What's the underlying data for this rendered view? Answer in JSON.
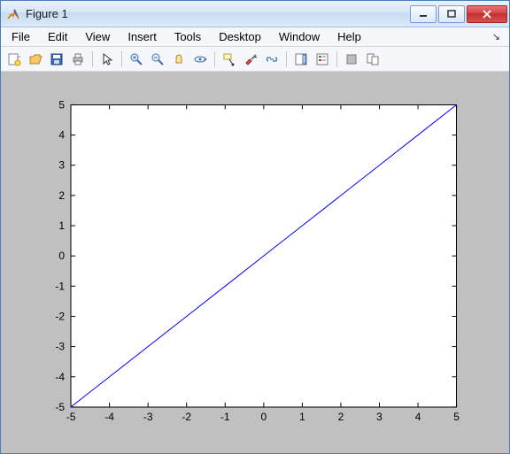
{
  "window": {
    "title": "Figure 1"
  },
  "menu": {
    "items": [
      "File",
      "Edit",
      "View",
      "Insert",
      "Tools",
      "Desktop",
      "Window",
      "Help"
    ]
  },
  "toolbar": {
    "groups": [
      [
        "new-figure-icon",
        "open-icon",
        "save-icon",
        "print-icon"
      ],
      [
        "pointer-icon"
      ],
      [
        "zoom-in-icon",
        "zoom-out-icon",
        "pan-icon",
        "rotate3d-icon"
      ],
      [
        "datacursor-icon",
        "brush-icon",
        "link-icon"
      ],
      [
        "colorbar-icon",
        "legend-icon"
      ],
      [
        "hide-plot-tools-icon",
        "show-plot-tools-icon"
      ]
    ]
  },
  "colors": {
    "line": "#0000ff",
    "axes_bg": "#ffffff",
    "figure_bg": "#c0c0c0"
  },
  "chart_data": {
    "type": "line",
    "x": [
      -5,
      -4,
      -3,
      -2,
      -1,
      0,
      1,
      2,
      3,
      4,
      5
    ],
    "y": [
      -5,
      -4,
      -3,
      -2,
      -1,
      0,
      1,
      2,
      3,
      4,
      5
    ],
    "xlim": [
      -5,
      5
    ],
    "ylim": [
      -5,
      5
    ],
    "xticks": [
      -5,
      -4,
      -3,
      -2,
      -1,
      0,
      1,
      2,
      3,
      4,
      5
    ],
    "yticks": [
      -5,
      -4,
      -3,
      -2,
      -1,
      0,
      1,
      2,
      3,
      4,
      5
    ],
    "xlabel": "",
    "ylabel": "",
    "title": "",
    "grid": false,
    "box": true,
    "series": [
      {
        "name": "",
        "color": "#0000ff"
      }
    ]
  }
}
